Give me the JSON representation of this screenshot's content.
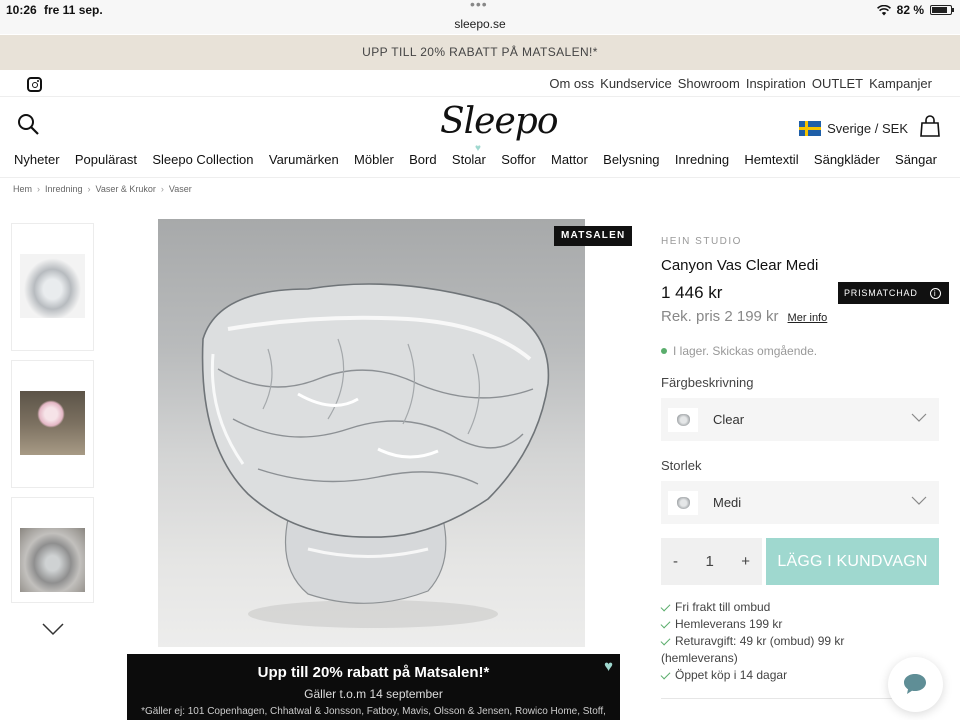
{
  "status": {
    "time": "10:26",
    "date": "fre 11 sep.",
    "url": "sleepo.se",
    "battery": "82 %"
  },
  "promo": {
    "text": "UPP TILL 20% RABATT PÅ MATSALEN!*"
  },
  "toplinks": [
    "Om oss",
    "Kundservice",
    "Showroom",
    "Inspiration",
    "OUTLET",
    "Kampanjer"
  ],
  "header": {
    "logo": "Sleepo",
    "country": "Sverige / SEK"
  },
  "nav": [
    "Nyheter",
    "Populärast",
    "Sleepo Collection",
    "Varumärken",
    "Möbler",
    "Bord",
    "Stolar",
    "Soffor",
    "Mattor",
    "Belysning",
    "Inredning",
    "Hemtextil",
    "Sängkläder",
    "Sängar"
  ],
  "breadcrumb": [
    "Hem",
    "Inredning",
    "Vaser & Krukor",
    "Vaser"
  ],
  "product": {
    "badge": "MATSALEN",
    "brand": "HEIN STUDIO",
    "name": "Canyon Vas Clear Medi",
    "price": "1 446 kr",
    "prisma_badge": "PRISMATCHAD",
    "rek_price": "Rek. pris 2 199 kr",
    "more_info": "Mer info",
    "stock": "I lager. Skickas omgående.",
    "color_label": "Färgbeskrivning",
    "color_value": "Clear",
    "size_label": "Storlek",
    "size_value": "Medi",
    "qty_minus": "-",
    "qty": "1",
    "qty_plus": "+",
    "add_to_cart": "LÄGG I KUNDVAGN",
    "usps": [
      "Fri frakt till ombud",
      "Hemleverans 199 kr",
      "Returavgift: 49 kr (ombud) 99 kr",
      "(hemleverans)",
      "Öppet köp i 14 dagar"
    ]
  },
  "banner": {
    "title": "Upp till 20% rabatt på Matsalen!*",
    "subtitle": "Gäller t.o.m 14 september",
    "fineprint": "*Gäller ej: 101 Copenhagen, Chhatwal & Jonsson, Fatboy, Mavis, Olsson & Jensen, Rowico Home, Stoff,"
  },
  "colors": {
    "accent": "#9fd8cf",
    "promo_bg": "#e8e2d8",
    "in_stock": "#5aad6c"
  }
}
